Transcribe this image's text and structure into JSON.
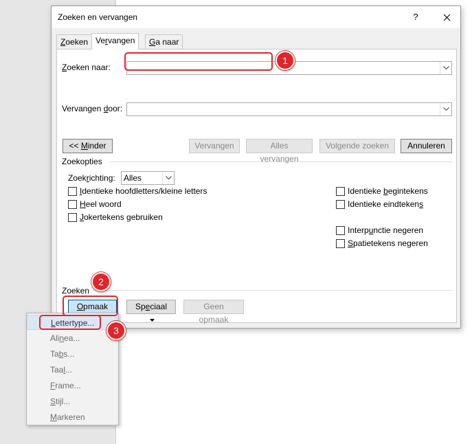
{
  "dialog": {
    "title": "Zoeken en vervangen",
    "help_glyph": "?",
    "tabs": [
      {
        "pre": "",
        "key": "Z",
        "post": "oeken"
      },
      {
        "pre": "Ve",
        "key": "r",
        "post": "vangen"
      },
      {
        "pre": "",
        "key": "G",
        "post": "a naar"
      }
    ],
    "find_label": {
      "pre": "",
      "key": "Z",
      "post": "oeken naar:"
    },
    "find_value": "",
    "replace_label": {
      "pre": "Vervangen ",
      "key": "d",
      "post": "oor:"
    },
    "replace_value": "",
    "less_button": {
      "pre": "<< ",
      "key": "M",
      "post": "inder"
    },
    "buttons": {
      "replace": "Vervangen",
      "replace_all": "Alles vervangen",
      "find_next": "Volgende zoeken",
      "cancel": "Annuleren"
    },
    "search_options": {
      "title": "Zoekopties",
      "direction_label": {
        "pre": "Zoek",
        "key": "r",
        "post": "ichting:"
      },
      "direction_value": "Alles",
      "left": [
        {
          "pre": "",
          "key": "I",
          "post": "dentieke hoofdletters/kleine letters"
        },
        {
          "pre": "",
          "key": "H",
          "post": "eel woord"
        },
        {
          "pre": "",
          "key": "J",
          "post": "okertekens gebruiken"
        }
      ],
      "right": [
        {
          "pre": "Identieke ",
          "key": "b",
          "post": "egintekens"
        },
        {
          "pre": "Identieke eindteken",
          "key": "s",
          "post": ""
        },
        {
          "pre": "Interp",
          "key": "u",
          "post": "nctie negeren"
        },
        {
          "pre": "",
          "key": "S",
          "post": "patietekens negeren"
        }
      ]
    },
    "find_section": {
      "title": "Zoeken",
      "format_button": {
        "pre": "",
        "key": "O",
        "post": "pmaak"
      },
      "special_button": {
        "pre": "Sp",
        "key": "e",
        "post": "ciaal"
      },
      "no_format": "Geen opmaak"
    }
  },
  "format_menu": [
    {
      "pre": "",
      "key": "L",
      "post": "ettertype..."
    },
    {
      "pre": "Ali",
      "key": "n",
      "post": "ea..."
    },
    {
      "pre": "Ta",
      "key": "b",
      "post": "s..."
    },
    {
      "pre": "Taa",
      "key": "l",
      "post": "..."
    },
    {
      "pre": "",
      "key": "F",
      "post": "rame..."
    },
    {
      "pre": "",
      "key": "S",
      "post": "tijl..."
    },
    {
      "pre": "",
      "key": "M",
      "post": "arkeren"
    }
  ],
  "annotations": [
    "1",
    "2",
    "3"
  ],
  "colors": {
    "annotation": "#e3242b",
    "menu_highlight": "#dbe7f4"
  }
}
